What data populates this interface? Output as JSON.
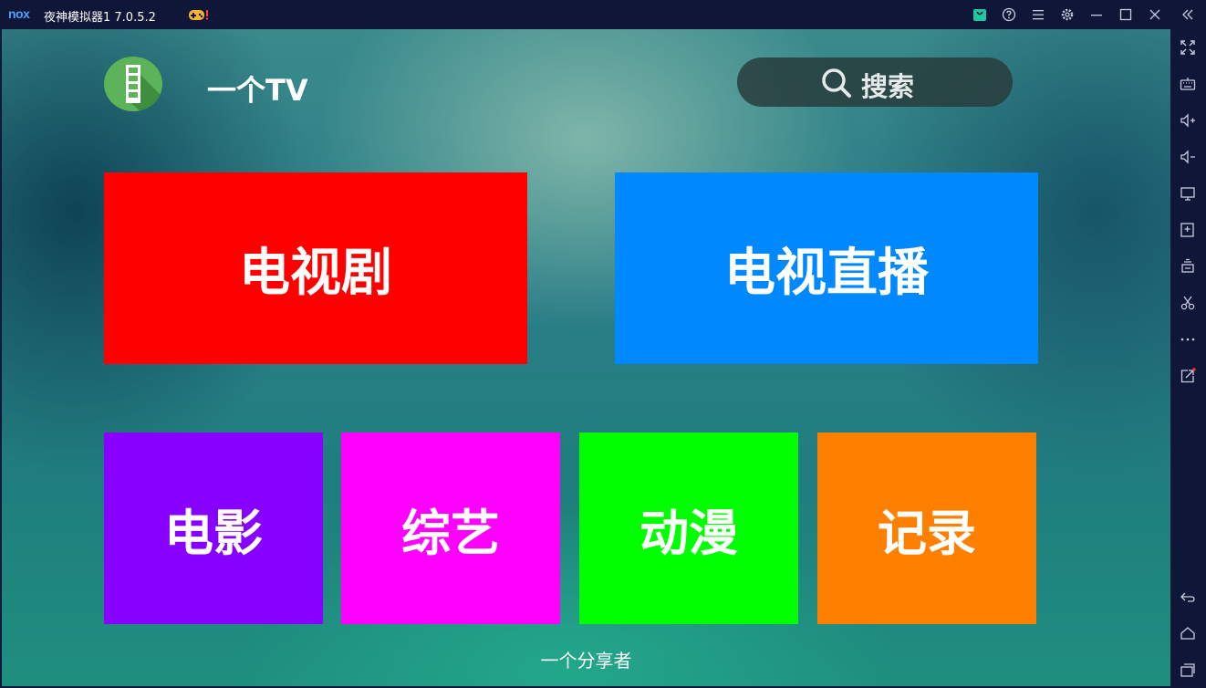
{
  "window": {
    "brand": "nox",
    "title": "夜神模拟器1 7.0.5.2"
  },
  "app": {
    "name": "一个TV",
    "search_label": "搜索",
    "tiles_top": [
      {
        "label": "电视剧",
        "color": "#ff0000"
      },
      {
        "label": "电视直播",
        "color": "#0088ff"
      }
    ],
    "tiles_bottom": [
      {
        "label": "电影",
        "color": "#8800ff"
      },
      {
        "label": "综艺",
        "color": "#ff00ff"
      },
      {
        "label": "动漫",
        "color": "#00ff00"
      },
      {
        "label": "记录",
        "color": "#ff8000"
      }
    ],
    "footer": "一个分享者"
  },
  "colors": {
    "titlebar": "#101637",
    "logo_green": "#5cb35a",
    "accent_green": "#1ec8a0"
  },
  "icons": {
    "titlebar": [
      "gamepad-icon",
      "store-icon",
      "help-icon",
      "menu-icon",
      "settings-icon",
      "minimize-icon",
      "maximize-icon",
      "close-icon",
      "collapse-icon"
    ],
    "sidebar": [
      "fullscreen-icon",
      "keyboard-icon",
      "volume-up-icon",
      "volume-down-icon",
      "screen-icon",
      "apk-install-icon",
      "multi-instance-icon",
      "screenshot-icon",
      "more-icon",
      "share-icon",
      "back-icon",
      "home-icon",
      "recent-apps-icon"
    ]
  }
}
